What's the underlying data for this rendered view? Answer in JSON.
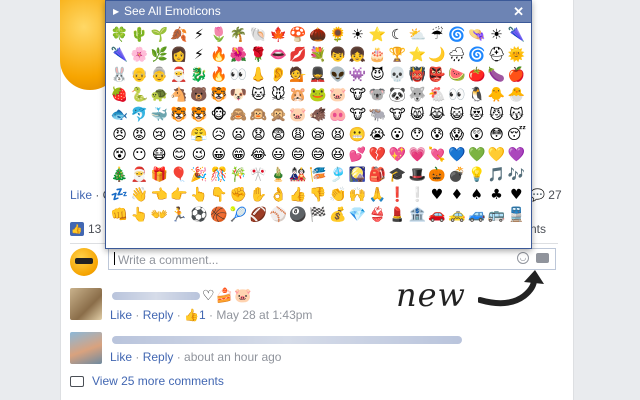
{
  "post": {
    "like_label": "Like",
    "comment_count": "27",
    "likes_count": "13",
    "sort_label": "nts"
  },
  "comment_input": {
    "placeholder": "Write a comment..."
  },
  "annotation": {
    "text": "new"
  },
  "comments": [
    {
      "emoticons": "♡🍰🐷",
      "like": "Like",
      "reply": "Reply",
      "likes": "1",
      "time": "May 28 at 1:43pm"
    },
    {
      "like": "Like",
      "reply": "Reply",
      "time": "about an hour ago"
    }
  ],
  "view_more": "View 25 more comments",
  "popup": {
    "title": "See All Emoticons",
    "emoticons": [
      "🍀",
      "🌵",
      "🌱",
      "🍂",
      "⚡",
      "🌷",
      "🌴",
      "🐚",
      "🍁",
      "🍄",
      "🌰",
      "🌻",
      "☀",
      "⭐",
      "☾",
      "⛅",
      "☔",
      "🌀",
      "👒",
      "☀",
      "🌂",
      "🌂",
      "🌸",
      "🌿",
      "👩",
      "⚡",
      "🔥",
      "🌺",
      "🌹",
      "👄",
      "💋",
      "💐",
      "👦",
      "👧",
      "🎂",
      "🏆",
      "⭐",
      "🌙",
      "🌧",
      "🌀",
      "⛑",
      "🌞",
      "🐰",
      "👴",
      "👵",
      "🎅",
      "🐉",
      "🔥",
      "👀",
      "👃",
      "👂",
      "💁",
      "💂",
      "👽",
      "👾",
      "😈",
      "💀",
      "👹",
      "👺",
      "🍉",
      "🍅",
      "🍆",
      "🍎",
      "🍓",
      "🐍",
      "🐢",
      "🐴",
      "🐻",
      "🐯",
      "🐶",
      "🐱",
      "🐭",
      "🐹",
      "🐸",
      "🐷",
      "🐮",
      "🐨",
      "🐼",
      "🐺",
      "🐔",
      "👀",
      "🐧",
      "🐥",
      "🐣",
      "🐟",
      "🐬",
      "🐳",
      "🐯",
      "🐯",
      "🐵",
      "🙈",
      "🙉",
      "🙊",
      "🐷",
      "🐗",
      "🐽",
      "🐮",
      "🐃",
      "🐮",
      "😸",
      "😹",
      "😺",
      "😻",
      "😼",
      "😽",
      "😠",
      "😡",
      "😢",
      "😣",
      "😤",
      "😥",
      "😦",
      "😧",
      "😨",
      "😩",
      "😪",
      "😫",
      "😬",
      "😭",
      "😮",
      "😯",
      "😰",
      "😱",
      "😲",
      "😳",
      "😴",
      "😵",
      "😶",
      "😷",
      "😊",
      "😉",
      "😀",
      "😁",
      "😂",
      "😃",
      "😄",
      "😅",
      "😆",
      "💕",
      "💔",
      "💖",
      "💗",
      "💘",
      "💙",
      "💚",
      "💛",
      "💜",
      "🎄",
      "🎅",
      "🎁",
      "🎈",
      "🎉",
      "🎊",
      "🎋",
      "🎌",
      "🎍",
      "🎎",
      "🎏",
      "🎐",
      "🎑",
      "🎒",
      "🎓",
      "🎩",
      "🎃",
      "💣",
      "💡",
      "🎵",
      "🎶",
      "💤",
      "👋",
      "👈",
      "👉",
      "👆",
      "👇",
      "✊",
      "✋",
      "👌",
      "👍",
      "👎",
      "👏",
      "🙌",
      "🙏",
      "❗",
      "❕",
      "♥",
      "♦",
      "♠",
      "♣",
      "♥",
      "👊",
      "👆",
      "👐",
      "🏃",
      "⚽",
      "🏀",
      "🎾",
      "🏈",
      "⚾",
      "🎱",
      "🏁",
      "💰",
      "💎",
      "👙",
      "💄",
      "🏦",
      "🚗",
      "🚕",
      "🚙",
      "🚌",
      "🚆"
    ]
  }
}
